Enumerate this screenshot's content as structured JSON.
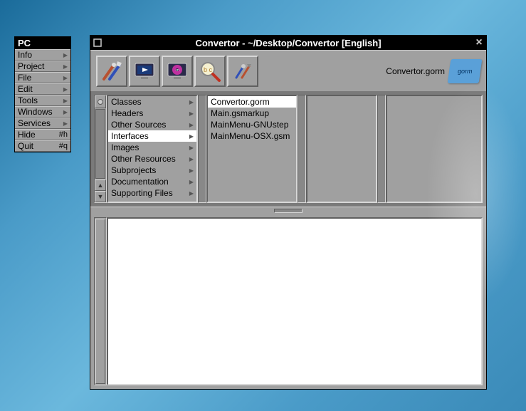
{
  "menu": {
    "title": "PC",
    "items": [
      {
        "label": "Info",
        "has_submenu": true
      },
      {
        "label": "Project",
        "has_submenu": true
      },
      {
        "label": "File",
        "has_submenu": true
      },
      {
        "label": "Edit",
        "has_submenu": true
      },
      {
        "label": "Tools",
        "has_submenu": true
      },
      {
        "label": "Windows",
        "has_submenu": true
      },
      {
        "label": "Services",
        "has_submenu": true
      },
      {
        "label": "Hide",
        "shortcut": "#h"
      },
      {
        "label": "Quit",
        "shortcut": "#q"
      }
    ]
  },
  "window": {
    "title": "Convertor - ~/Desktop/Convertor [English]",
    "file_label": "Convertor.gorm",
    "badge": "gorm"
  },
  "browser": {
    "col1": [
      {
        "label": "Classes",
        "branch": true
      },
      {
        "label": "Headers",
        "branch": true
      },
      {
        "label": "Other Sources",
        "branch": true
      },
      {
        "label": "Interfaces",
        "branch": true,
        "selected": true
      },
      {
        "label": "Images",
        "branch": true
      },
      {
        "label": "Other Resources",
        "branch": true
      },
      {
        "label": "Subprojects",
        "branch": true
      },
      {
        "label": "Documentation",
        "branch": true
      },
      {
        "label": "Supporting Files",
        "branch": true
      }
    ],
    "col2": [
      {
        "label": "Convertor.gorm",
        "selected": true
      },
      {
        "label": "Main.gsmarkup"
      },
      {
        "label": "MainMenu-GNUstep"
      },
      {
        "label": "MainMenu-OSX.gsm"
      }
    ]
  }
}
